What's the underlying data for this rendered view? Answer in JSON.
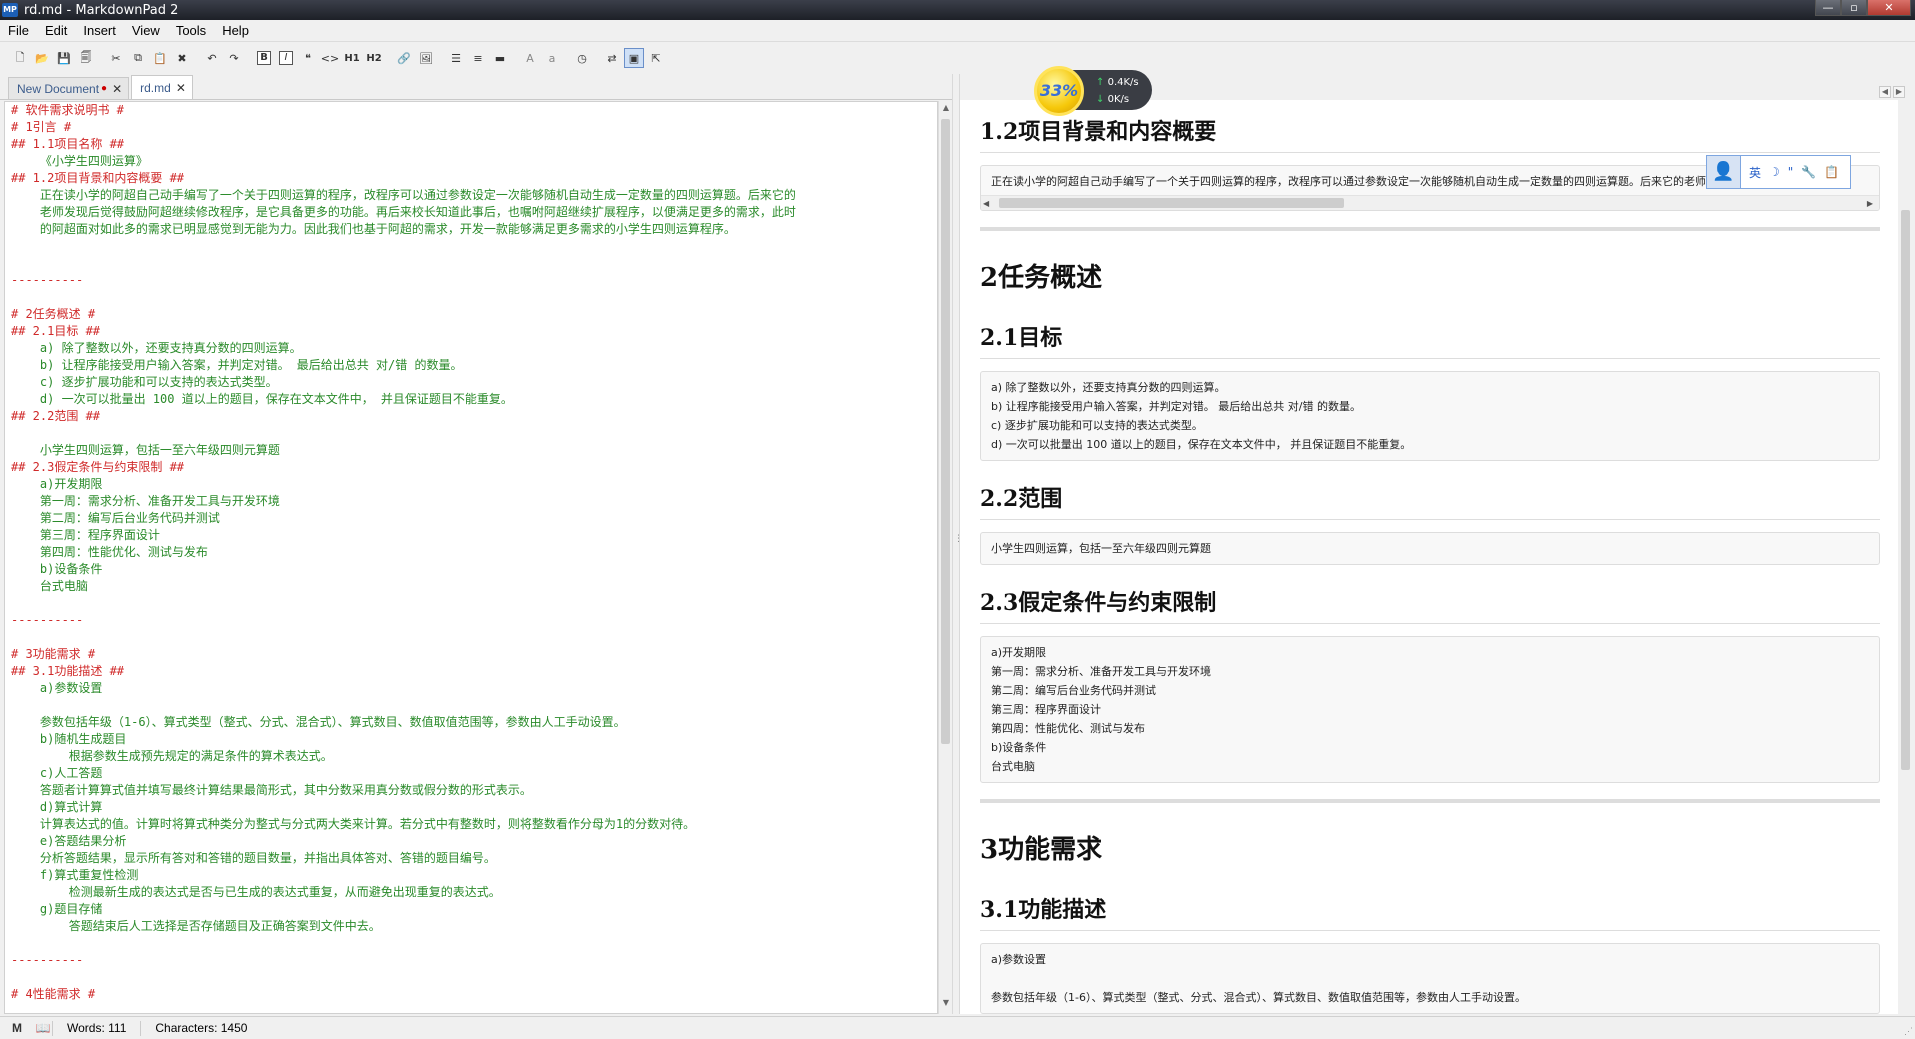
{
  "window": {
    "title": "rd.md - MarkdownPad 2",
    "app_icon": "MP"
  },
  "menu": [
    "File",
    "Edit",
    "Insert",
    "View",
    "Tools",
    "Help"
  ],
  "toolbar_icons": [
    "new-document-icon",
    "open-icon",
    "save-icon",
    "save-all-icon",
    "cut-icon",
    "copy-icon",
    "paste-icon",
    "delete-icon",
    "undo-icon",
    "redo-icon",
    "bold-icon",
    "italic-icon",
    "quote-icon",
    "code-icon",
    "heading1-icon",
    "heading2-icon",
    "link-icon",
    "image-icon",
    "unordered-list-icon",
    "ordered-list-icon",
    "horizontal-rule-icon",
    "uppercase-icon",
    "lowercase-icon",
    "timestamp-icon",
    "swap-icon",
    "live-preview-icon",
    "export-icon"
  ],
  "toolbar_labels": {
    "bold": "B",
    "italic": "I",
    "h1": "H1",
    "h2": "H2",
    "upper": "A",
    "lower": "a"
  },
  "tabs": [
    {
      "label": "New Document",
      "modified": "●",
      "close": "✕"
    },
    {
      "label": "rd.md",
      "close": "✕"
    }
  ],
  "editor_lines": [
    {
      "t": "h",
      "text": "# 软件需求说明书 #"
    },
    {
      "t": "h",
      "text": "# 1引言 #"
    },
    {
      "t": "h",
      "text": "## 1.1项目名称 ##"
    },
    {
      "t": "b",
      "text": "    《小学生四则运算》"
    },
    {
      "t": "h",
      "text": "## 1.2项目背景和内容概要 ##"
    },
    {
      "t": "b",
      "text": "    正在读小学的阿超自己动手编写了一个关于四则运算的程序，改程序可以通过参数设定一次能够随机自动生成一定数量的四则运算题。后来它的"
    },
    {
      "t": "b",
      "text": "    老师发现后觉得鼓励阿超继续修改程序，是它具备更多的功能。再后来校长知道此事后，也嘱咐阿超继续扩展程序，以便满足更多的需求，此时"
    },
    {
      "t": "b",
      "text": "    的阿超面对如此多的需求已明显感觉到无能为力。因此我们也基于阿超的需求，开发一款能够满足更多需求的小学生四则运算程序。"
    },
    {
      "t": "blank",
      "text": ""
    },
    {
      "t": "blank",
      "text": ""
    },
    {
      "t": "rule",
      "text": "----------"
    },
    {
      "t": "blank",
      "text": ""
    },
    {
      "t": "h",
      "text": "# 2任务概述 #"
    },
    {
      "t": "h",
      "text": "## 2.1目标 ##"
    },
    {
      "t": "b",
      "text": "    a) 除了整数以外，还要支持真分数的四则运算。"
    },
    {
      "t": "b",
      "text": "    b) 让程序能接受用户输入答案，并判定对错。 最后给出总共 对/错 的数量。"
    },
    {
      "t": "b",
      "text": "    c) 逐步扩展功能和可以支持的表达式类型。"
    },
    {
      "t": "b",
      "text": "    d) 一次可以批量出 100 道以上的题目，保存在文本文件中， 并且保证题目不能重复。"
    },
    {
      "t": "h",
      "text": "## 2.2范围 ##"
    },
    {
      "t": "blank",
      "text": ""
    },
    {
      "t": "b",
      "text": "    小学生四则运算，包括一至六年级四则元算题"
    },
    {
      "t": "h",
      "text": "## 2.3假定条件与约束限制 ##"
    },
    {
      "t": "b",
      "text": "    a)开发期限"
    },
    {
      "t": "b",
      "text": "    第一周：需求分析、准备开发工具与开发环境"
    },
    {
      "t": "b",
      "text": "    第二周：编写后台业务代码并测试"
    },
    {
      "t": "b",
      "text": "    第三周：程序界面设计"
    },
    {
      "t": "b",
      "text": "    第四周：性能优化、测试与发布"
    },
    {
      "t": "b",
      "text": "    b)设备条件"
    },
    {
      "t": "b",
      "text": "    台式电脑"
    },
    {
      "t": "blank",
      "text": ""
    },
    {
      "t": "rule",
      "text": "----------"
    },
    {
      "t": "blank",
      "text": ""
    },
    {
      "t": "h",
      "text": "# 3功能需求 #"
    },
    {
      "t": "h",
      "text": "## 3.1功能描述 ##"
    },
    {
      "t": "b",
      "text": "    a)参数设置"
    },
    {
      "t": "blank",
      "text": ""
    },
    {
      "t": "b",
      "text": "    参数包括年级（1-6）、算式类型（整式、分式、混合式）、算式数目、数值取值范围等，参数由人工手动设置。"
    },
    {
      "t": "b",
      "text": "    b)随机生成题目"
    },
    {
      "t": "b",
      "text": "        根据参数生成预先规定的满足条件的算术表达式。"
    },
    {
      "t": "b",
      "text": "    c)人工答题"
    },
    {
      "t": "b",
      "text": "    答题者计算算式值并填写最终计算结果最简形式，其中分数采用真分数或假分数的形式表示。"
    },
    {
      "t": "b",
      "text": "    d)算式计算"
    },
    {
      "t": "b",
      "text": "    计算表达式的值。计算时将算式种类分为整式与分式两大类来计算。若分式中有整数时，则将整数看作分母为1的分数对待。"
    },
    {
      "t": "b",
      "text": "    e)答题结果分析"
    },
    {
      "t": "b",
      "text": "    分析答题结果，显示所有答对和答错的题目数量，并指出具体答对、答错的题目编号。"
    },
    {
      "t": "b",
      "text": "    f)算式重复性检测"
    },
    {
      "t": "b",
      "text": "        检测最新生成的表达式是否与已生成的表达式重复，从而避免出现重复的表达式。"
    },
    {
      "t": "b",
      "text": "    g)题目存储"
    },
    {
      "t": "b",
      "text": "        答题结束后人工选择是否存储题目及正确答案到文件中去。"
    },
    {
      "t": "blank",
      "text": ""
    },
    {
      "t": "rule",
      "text": "----------"
    },
    {
      "t": "blank",
      "text": ""
    },
    {
      "t": "h",
      "text": "# 4性能需求 #"
    }
  ],
  "preview": {
    "h2_1_2": "1.2项目背景和内容概要",
    "p_1_2": "正在读小学的阿超自己动手编写了一个关于四则运算的程序，改程序可以通过参数设定一次能够随机自动生成一定数量的四则运算题。后来它的老师发现后觉得鼓励阿超",
    "h1_2": "2任务概述",
    "h2_2_1": "2.1目标",
    "list_2_1": [
      "a) 除了整数以外，还要支持真分数的四则运算。",
      "b) 让程序能接受用户输入答案，并判定对错。 最后给出总共 对/错 的数量。",
      "c) 逐步扩展功能和可以支持的表达式类型。",
      "d) 一次可以批量出 100 道以上的题目，保存在文本文件中， 并且保证题目不能重复。"
    ],
    "h2_2_2": "2.2范围",
    "p_2_2": "小学生四则运算，包括一至六年级四则元算题",
    "h2_2_3": "2.3假定条件与约束限制",
    "list_2_3": [
      "a)开发期限",
      "第一周：需求分析、准备开发工具与开发环境",
      "第二周：编写后台业务代码并测试",
      "第三周：程序界面设计",
      "第四周：性能优化、测试与发布",
      "b)设备条件",
      "台式电脑"
    ],
    "h1_3": "3功能需求",
    "h2_3_1": "3.1功能描述",
    "list_3_1": [
      "a)参数设置",
      "",
      "参数包括年级（1-6）、算式类型（整式、分式、混合式）、算式数目、数值取值范围等，参数由人工手动设置。"
    ]
  },
  "net_widget": {
    "percent": "33%",
    "upload": "0.4K/s",
    "download": "0K/s"
  },
  "ime": {
    "lang": "英",
    "symbols": [
      "☽",
      "\"",
      "🔧",
      "📋"
    ]
  },
  "status": {
    "words": "Words: 111",
    "characters": "Characters: 1450"
  }
}
